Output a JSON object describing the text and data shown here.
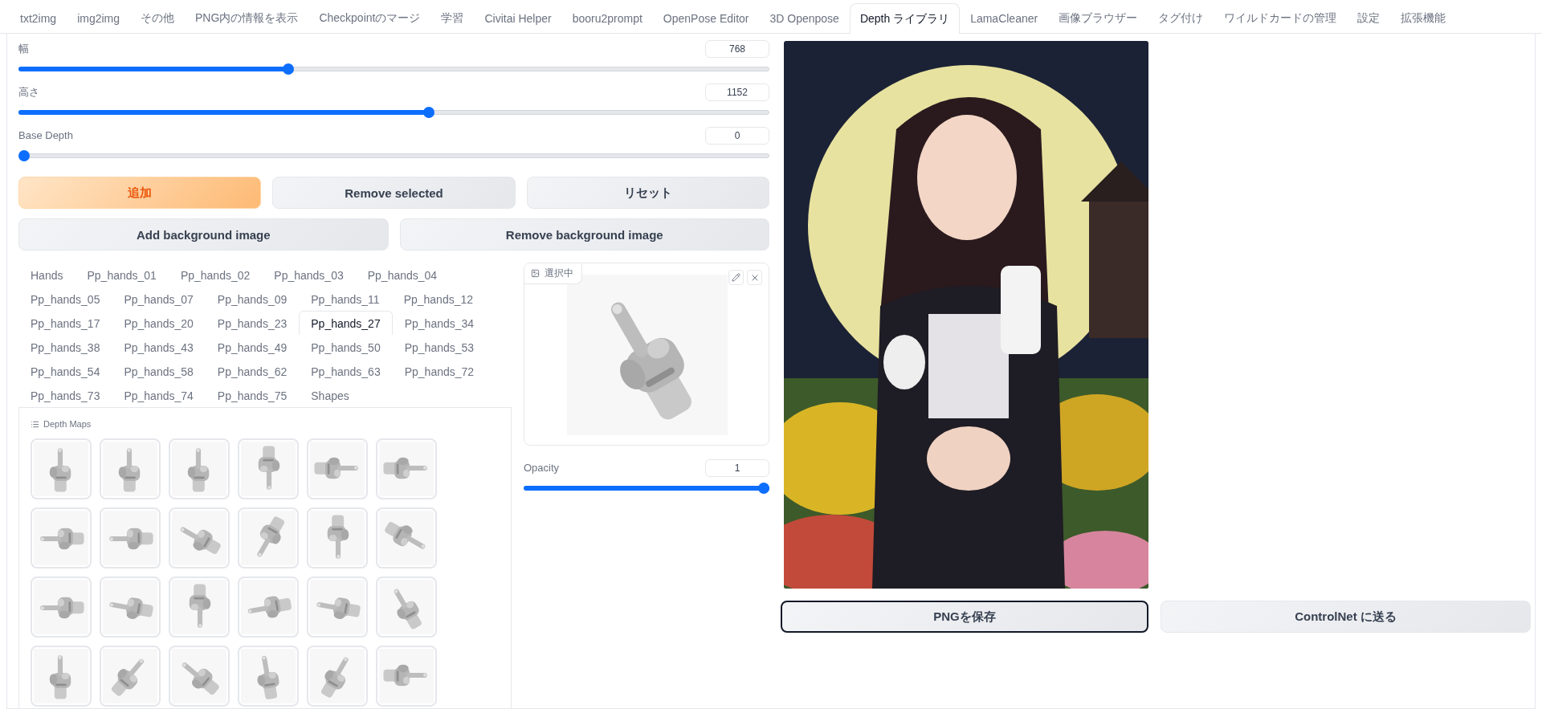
{
  "tabs": [
    {
      "label": "txt2img",
      "selected": false
    },
    {
      "label": "img2img",
      "selected": false
    },
    {
      "label": "その他",
      "selected": false
    },
    {
      "label": "PNG内の情報を表示",
      "selected": false
    },
    {
      "label": "Checkpointのマージ",
      "selected": false
    },
    {
      "label": "学習",
      "selected": false
    },
    {
      "label": "Civitai Helper",
      "selected": false
    },
    {
      "label": "booru2prompt",
      "selected": false
    },
    {
      "label": "OpenPose Editor",
      "selected": false
    },
    {
      "label": "3D Openpose",
      "selected": false
    },
    {
      "label": "Depth ライブラリ",
      "selected": true
    },
    {
      "label": "LamaCleaner",
      "selected": false
    },
    {
      "label": "画像ブラウザー",
      "selected": false
    },
    {
      "label": "タグ付け",
      "selected": false
    },
    {
      "label": "ワイルドカードの管理",
      "selected": false
    },
    {
      "label": "設定",
      "selected": false
    },
    {
      "label": "拡張機能",
      "selected": false
    }
  ],
  "sliders": [
    {
      "label": "幅",
      "value": "768",
      "level": 0.357
    },
    {
      "label": "高さ",
      "value": "1152",
      "level": 0.547
    },
    {
      "label": "Base Depth",
      "value": "0",
      "level": 0
    }
  ],
  "buttons_row_1": [
    {
      "label": "追加",
      "kind": "primary"
    },
    {
      "label": "Remove selected",
      "kind": "secondary"
    },
    {
      "label": "リセット",
      "kind": "secondary"
    }
  ],
  "buttons_row_2": [
    {
      "label": "Add background image",
      "kind": "secondary"
    },
    {
      "label": "Remove background image",
      "kind": "secondary"
    }
  ],
  "library_tabs": [
    {
      "label": "Hands",
      "selected": false
    },
    {
      "label": "Pp_hands_01",
      "selected": false
    },
    {
      "label": "Pp_hands_02",
      "selected": false
    },
    {
      "label": "Pp_hands_03",
      "selected": false
    },
    {
      "label": "Pp_hands_04",
      "selected": false
    },
    {
      "label": "Pp_hands_05",
      "selected": false
    },
    {
      "label": "Pp_hands_07",
      "selected": false
    },
    {
      "label": "Pp_hands_09",
      "selected": false
    },
    {
      "label": "Pp_hands_11",
      "selected": false
    },
    {
      "label": "Pp_hands_12",
      "selected": false
    },
    {
      "label": "Pp_hands_17",
      "selected": false
    },
    {
      "label": "Pp_hands_20",
      "selected": false
    },
    {
      "label": "Pp_hands_23",
      "selected": false
    },
    {
      "label": "Pp_hands_27",
      "selected": true
    },
    {
      "label": "Pp_hands_34",
      "selected": false
    },
    {
      "label": "Pp_hands_38",
      "selected": false
    },
    {
      "label": "Pp_hands_43",
      "selected": false
    },
    {
      "label": "Pp_hands_49",
      "selected": false
    },
    {
      "label": "Pp_hands_50",
      "selected": false
    },
    {
      "label": "Pp_hands_53",
      "selected": false
    },
    {
      "label": "Pp_hands_54",
      "selected": false
    },
    {
      "label": "Pp_hands_58",
      "selected": false
    },
    {
      "label": "Pp_hands_62",
      "selected": false
    },
    {
      "label": "Pp_hands_63",
      "selected": false
    },
    {
      "label": "Pp_hands_72",
      "selected": false
    },
    {
      "label": "Pp_hands_73",
      "selected": false
    },
    {
      "label": "Pp_hands_74",
      "selected": false
    },
    {
      "label": "Pp_hands_75",
      "selected": false
    },
    {
      "label": "Shapes",
      "selected": false
    }
  ],
  "depth_maps": {
    "title": "Depth Maps"
  },
  "preview": {
    "label": "選択中",
    "kind": "picture"
  },
  "opacity": {
    "label": "Opacity",
    "value": "1",
    "level": 1
  },
  "output_buttons": [
    {
      "label": "PNGを保存",
      "focused": true
    },
    {
      "label": "ControlNet に送る",
      "focused": false
    }
  ]
}
